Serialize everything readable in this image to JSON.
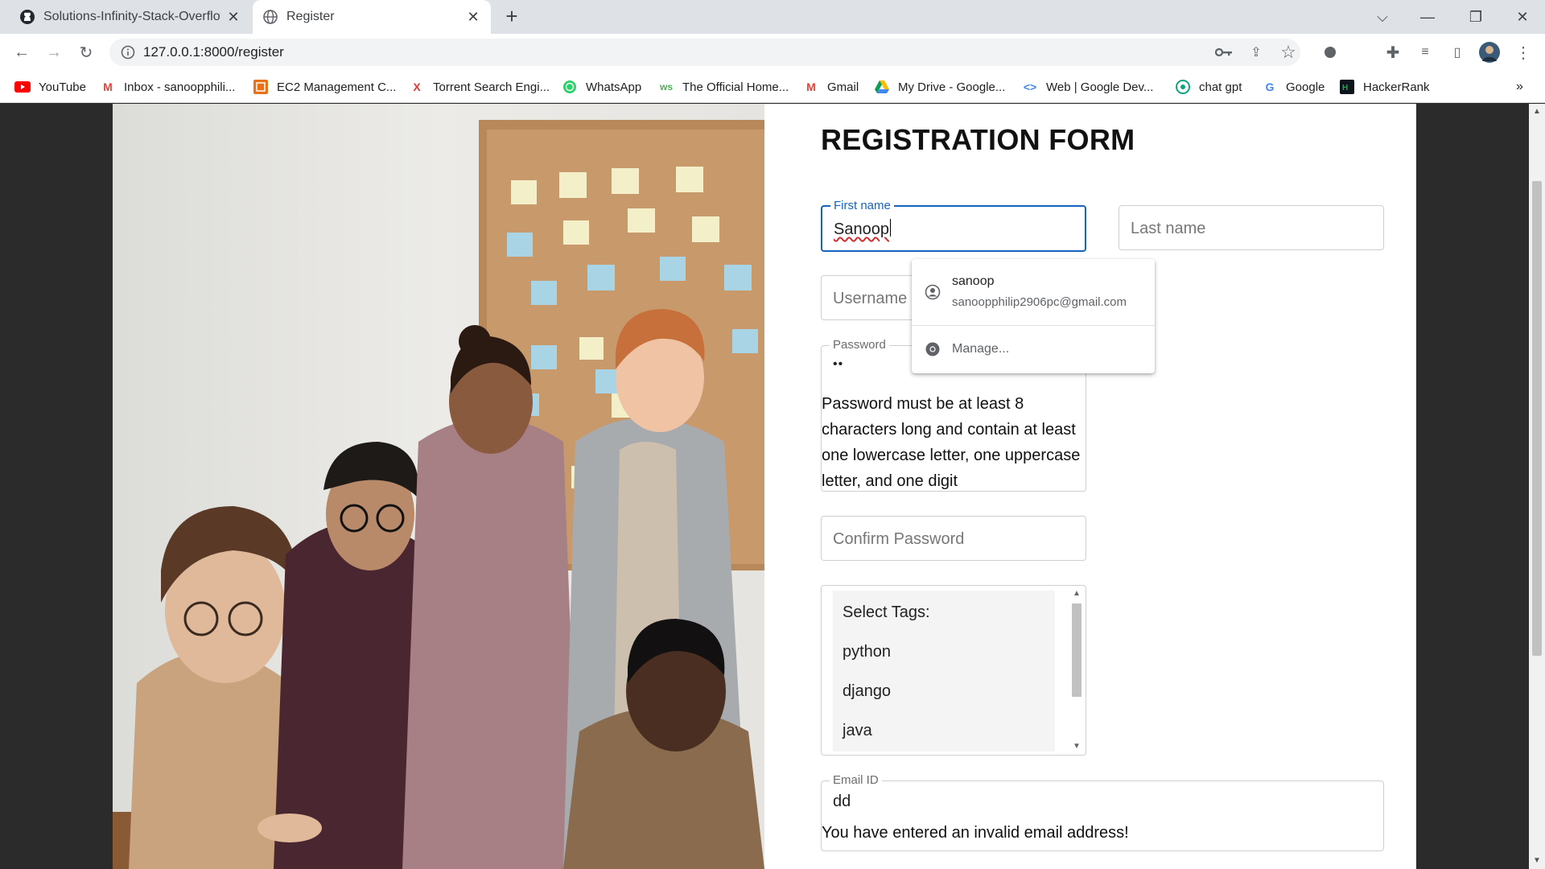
{
  "browser": {
    "tabs": [
      {
        "title": "Solutions-Infinity-Stack-Overflow",
        "icon": "github-icon",
        "active": false
      },
      {
        "title": "Register",
        "icon": "globe-icon",
        "active": true
      }
    ],
    "url": "127.0.0.1:8000/register",
    "bookmarks": [
      {
        "label": "YouTube",
        "icon": "youtube-icon",
        "color": "#ff0000"
      },
      {
        "label": "Inbox - sanoopphili...",
        "icon": "gmail-icon",
        "color": "#ea4335"
      },
      {
        "label": "EC2 Management C...",
        "icon": "aws-icon",
        "color": "#e8711a"
      },
      {
        "label": "Torrent Search Engi...",
        "icon": "x-icon",
        "color": "#e53935"
      },
      {
        "label": "WhatsApp",
        "icon": "whatsapp-icon",
        "color": "#25d366"
      },
      {
        "label": "The Official Home...",
        "icon": "site-icon",
        "color": "#4caf50"
      },
      {
        "label": "Gmail",
        "icon": "gmail-icon",
        "color": "#ea4335"
      },
      {
        "label": "My Drive - Google...",
        "icon": "drive-icon",
        "color": "#fbbc04"
      },
      {
        "label": "Web  |  Google Dev...",
        "icon": "code-icon",
        "color": "#4285f4"
      },
      {
        "label": "chat gpt",
        "icon": "chatgpt-icon",
        "color": "#10a37f"
      },
      {
        "label": "Google",
        "icon": "google-icon",
        "color": "#4285f4"
      },
      {
        "label": "HackerRank",
        "icon": "hackerrank-icon",
        "color": "#1ba94c"
      }
    ]
  },
  "form": {
    "title": "REGISTRATION FORM",
    "first_name": {
      "label": "First name",
      "value": "Sanoop"
    },
    "last_name": {
      "placeholder": "Last name"
    },
    "username": {
      "placeholder": "Username"
    },
    "password": {
      "label": "Password",
      "value": "••",
      "hint": "Password must be at least 8 characters long and contain at least one lowercase letter, one uppercase letter, and one digit"
    },
    "confirm_password": {
      "placeholder": "Confirm Password"
    },
    "tags": {
      "options": [
        "Select Tags:",
        "python",
        "django",
        "java"
      ]
    },
    "email": {
      "label": "Email ID",
      "value": "dd",
      "error": "You have entered an invalid email address!"
    }
  },
  "autofill": {
    "name": "sanoop",
    "email": "sanoopphilip2906pc@gmail.com",
    "manage": "Manage..."
  }
}
